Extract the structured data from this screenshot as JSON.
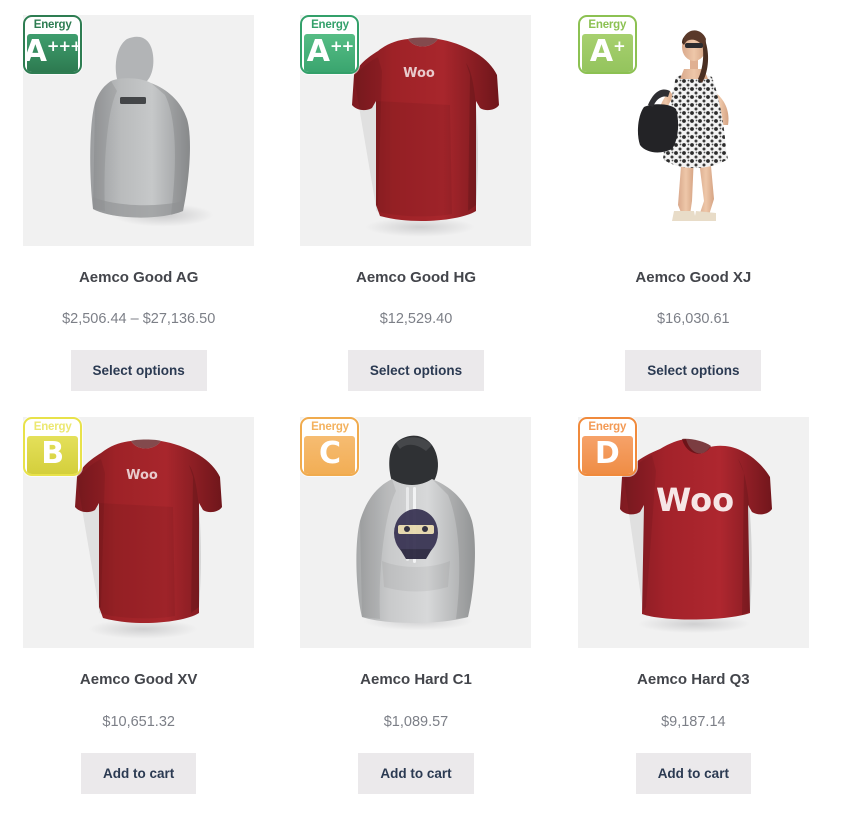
{
  "page": {
    "type": "product-grid",
    "columns": 3,
    "rows": 2
  },
  "badge_colors": {
    "a_plus_plus_plus": {
      "border": "#2e7d52",
      "plate_top": "#3f9e6e",
      "plate_bottom": "#2d7a50",
      "word": "#2e7d52"
    },
    "a_plus_plus": {
      "border": "#33a06a",
      "plate_top": "#56bd85",
      "plate_bottom": "#3aa56f",
      "word": "#33a06a"
    },
    "a_plus": {
      "border": "#8cc152",
      "plate_top": "#a7d06f",
      "plate_bottom": "#94c45d",
      "word": "#8cc152"
    },
    "b": {
      "border": "#e8e24a",
      "plate_top": "#e4e05a",
      "plate_bottom": "#d4cf3c",
      "word": "#ece871"
    },
    "c": {
      "border": "#f0ab4e",
      "plate_top": "#f6bc72",
      "plate_bottom": "#f2ae55",
      "word": "#f3b25f"
    },
    "d": {
      "border": "#f08a3c",
      "plate_top": "#f6a269",
      "plate_bottom": "#ef8d45",
      "word": "#f39a55"
    }
  },
  "products": [
    {
      "title": "Aemco Good AG",
      "price": "$2,506.44 – $27,136.50",
      "button": "Select options",
      "badge": {
        "word": "Energy",
        "grade": "A",
        "plus": "+++",
        "style": "a_plus_plus_plus"
      },
      "image": {
        "name": "grey-hoodie-back-product-image",
        "art": "hoodie-back",
        "color": "#b9bbbc"
      }
    },
    {
      "title": "Aemco Good HG",
      "price": "$12,529.40",
      "button": "Select options",
      "badge": {
        "word": "Energy",
        "grade": "A",
        "plus": "++",
        "style": "a_plus_plus"
      },
      "image": {
        "name": "red-tshirt-back-product-image",
        "art": "tee-back",
        "color": "#9e2227",
        "print": "Woo"
      }
    },
    {
      "title": "Aemco Good XJ",
      "price": "$16,030.61",
      "button": "Select options",
      "badge": {
        "word": "Energy",
        "grade": "A",
        "plus": "+",
        "style": "a_plus"
      },
      "image": {
        "name": "woman-floral-dress-handbag-product-image",
        "art": "model-dress",
        "color": "#ffffff"
      }
    },
    {
      "title": "Aemco Good XV",
      "price": "$10,651.32",
      "button": "Add to cart",
      "badge": {
        "word": "Energy",
        "grade": "B",
        "plus": "",
        "style": "b"
      },
      "image": {
        "name": "red-tshirt-back-product-image",
        "art": "tee-back",
        "color": "#9e2227",
        "print": "Woo"
      }
    },
    {
      "title": "Aemco Hard C1",
      "price": "$1,089.57",
      "button": "Add to cart",
      "badge": {
        "word": "Energy",
        "grade": "C",
        "plus": "",
        "style": "c"
      },
      "image": {
        "name": "grey-ninja-hoodie-product-image",
        "art": "hoodie-front",
        "color": "#c9cacb"
      }
    },
    {
      "title": "Aemco Hard Q3",
      "price": "$9,187.14",
      "button": "Add to cart",
      "badge": {
        "word": "Energy",
        "grade": "D",
        "plus": "",
        "style": "d"
      },
      "image": {
        "name": "red-woo-tshirt-product-image",
        "art": "tee-front",
        "color": "#a3222a",
        "print": "Woo"
      }
    }
  ]
}
